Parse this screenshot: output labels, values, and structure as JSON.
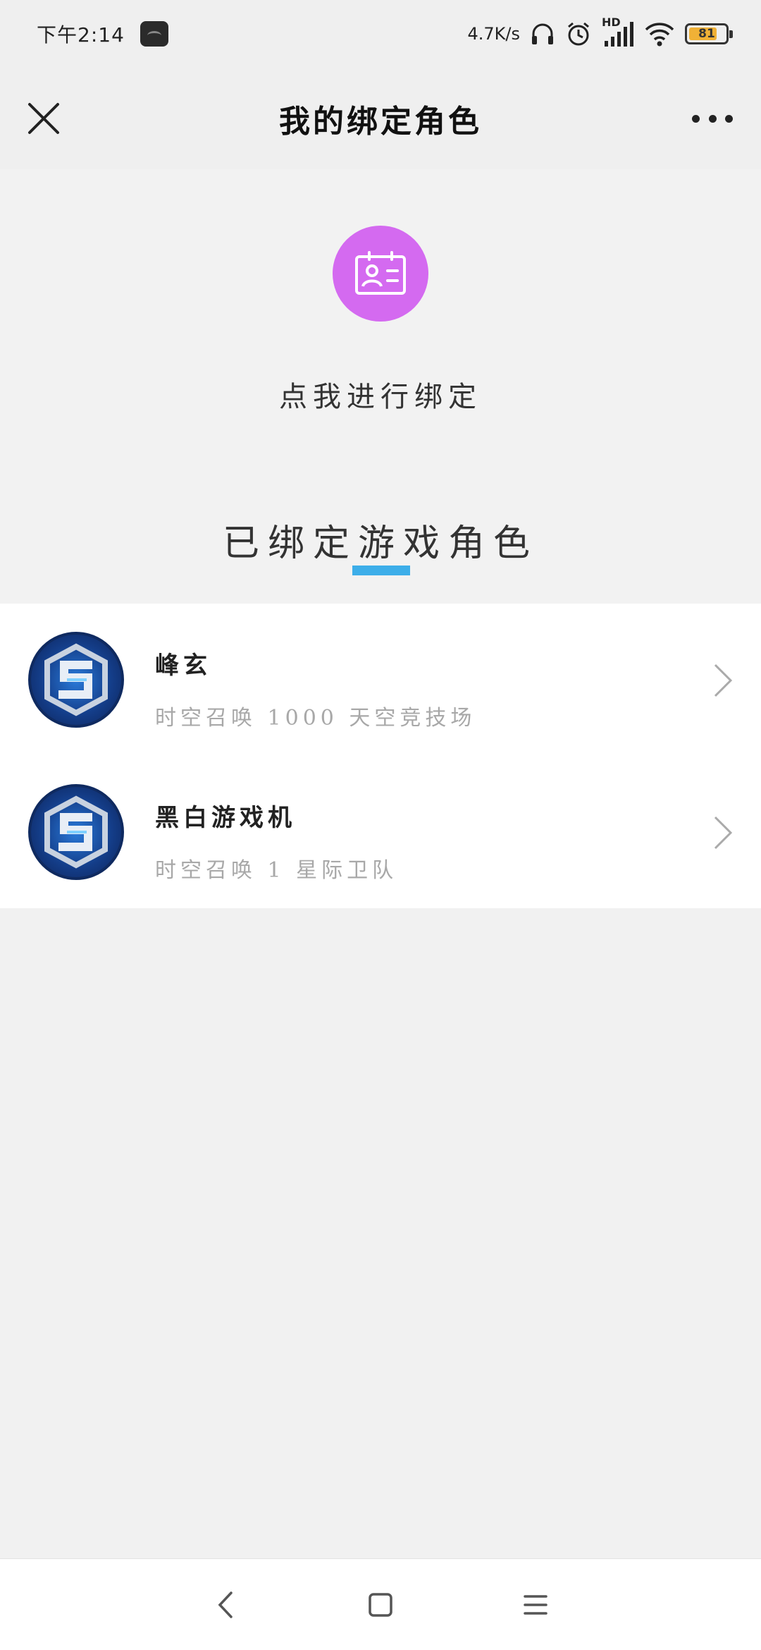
{
  "status_bar": {
    "time": "下午2:14",
    "net_speed": "4.7K/s",
    "network_label": "HD",
    "battery": "81",
    "battery_level_percent": 81
  },
  "header": {
    "title": "我的绑定角色"
  },
  "bind": {
    "label": "点我进行绑定",
    "icon": "id-card-icon",
    "icon_color": "#d46af0"
  },
  "section": {
    "title": "已绑定游戏角色",
    "accent": "#3daee9"
  },
  "roles": [
    {
      "name": "峰玄",
      "desc": "时空召唤 1000 天空竞技场"
    },
    {
      "name": "黑白游戏机",
      "desc": "时空召唤 1 星际卫队"
    }
  ]
}
